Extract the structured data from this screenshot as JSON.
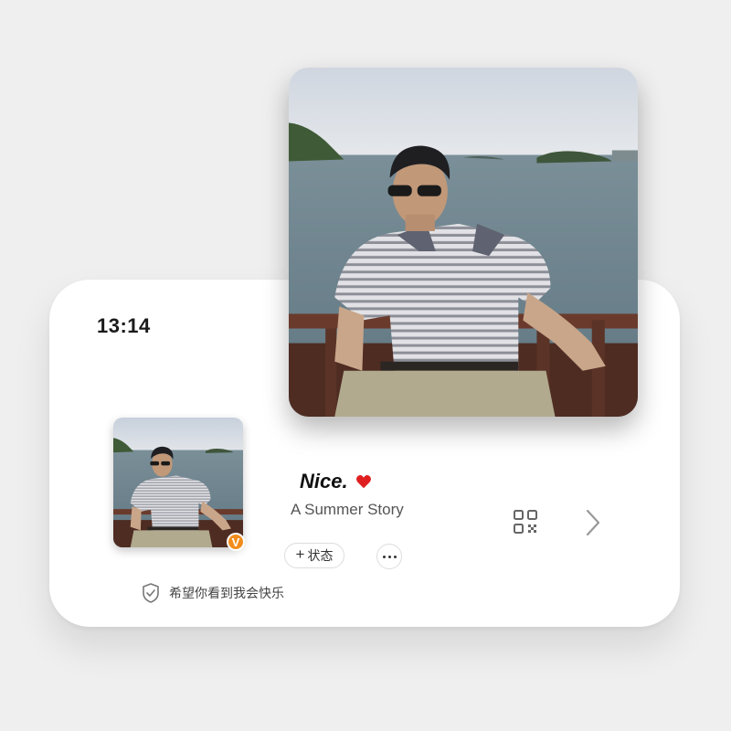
{
  "status_bar": {
    "time": "13:14"
  },
  "profile": {
    "name": "Nice.",
    "subtitle": "A Summer Story",
    "verified_badge": "V",
    "status_button_label": "状态",
    "status_button_icon": "plus-icon",
    "more_button_icon": "ellipsis-icon",
    "bio": "希望你看到我会快乐",
    "bio_icon": "shield-icon"
  },
  "icons": {
    "name_suffix": "heart-icon",
    "qr": "qr-code-icon",
    "navigate": "chevron-right-icon"
  },
  "colors": {
    "background": "#efefef",
    "card": "#ffffff",
    "heart": "#e02020",
    "verified_badge": "#f28c1c"
  }
}
